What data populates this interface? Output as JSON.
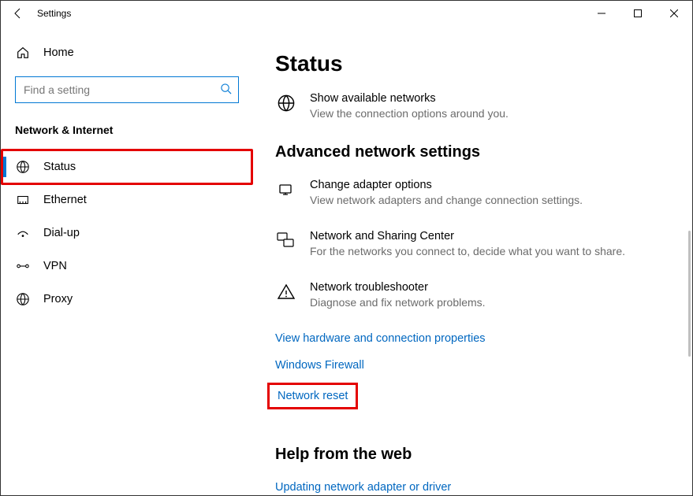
{
  "titlebar": {
    "title": "Settings"
  },
  "sidebar": {
    "home_label": "Home",
    "search_placeholder": "Find a setting",
    "section_label": "Network & Internet",
    "items": [
      {
        "label": "Status"
      },
      {
        "label": "Ethernet"
      },
      {
        "label": "Dial-up"
      },
      {
        "label": "VPN"
      },
      {
        "label": "Proxy"
      }
    ]
  },
  "main": {
    "page_title": "Status",
    "show_networks": {
      "title": "Show available networks",
      "desc": "View the connection options around you."
    },
    "advanced_title": "Advanced network settings",
    "adapter": {
      "title": "Change adapter options",
      "desc": "View network adapters and change connection settings."
    },
    "sharing": {
      "title": "Network and Sharing Center",
      "desc": "For the networks you connect to, decide what you want to share."
    },
    "troubleshoot": {
      "title": "Network troubleshooter",
      "desc": "Diagnose and fix network problems."
    },
    "links": {
      "hardware": "View hardware and connection properties",
      "firewall": "Windows Firewall",
      "reset": "Network reset"
    },
    "help_title": "Help from the web",
    "help_link": "Updating network adapter or driver"
  }
}
